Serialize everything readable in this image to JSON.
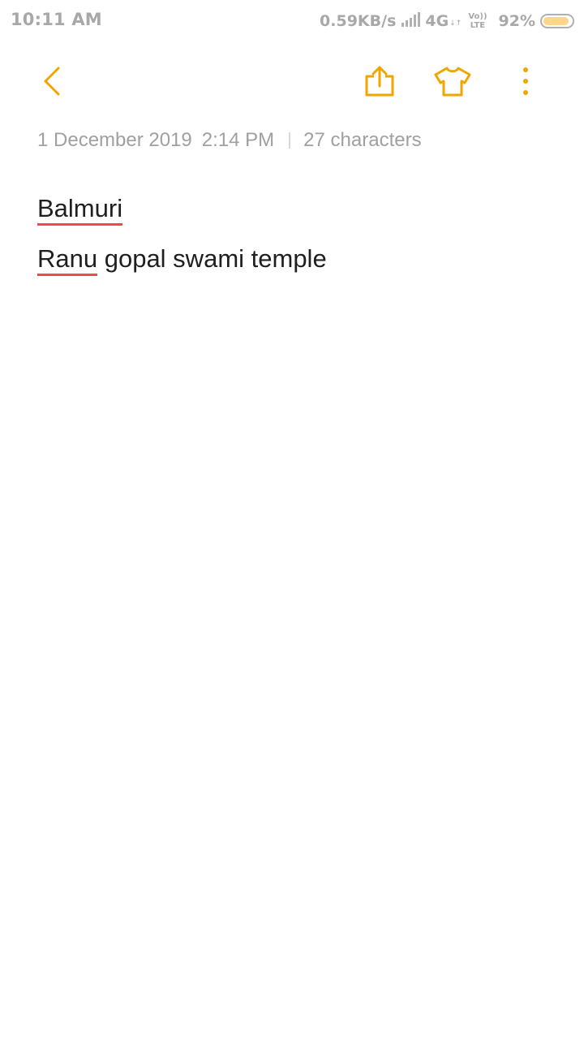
{
  "status_bar": {
    "time": "10:11 AM",
    "net_speed": "0.59KB/s",
    "network_type": "4G",
    "network_arrows": "↓↑",
    "volte_top": "Vo))",
    "volte_bottom": "LTE",
    "battery_percent": "92%",
    "battery_level": 0.92,
    "icons": [
      "signal-icon",
      "battery-icon"
    ]
  },
  "toolbar": {
    "accent_color": "#f0a500",
    "icons": [
      "back-icon",
      "share-icon",
      "theme-shirt-icon",
      "more-icon"
    ]
  },
  "meta": {
    "date": "1 December 2019",
    "time": "2:14 PM",
    "char_count": "27 characters"
  },
  "note": {
    "line1_word": "Balmuri",
    "line2_misspelled": "Ranu",
    "line2_rest": " gopal swami temple",
    "spellcheck_color": "#f0484d"
  }
}
